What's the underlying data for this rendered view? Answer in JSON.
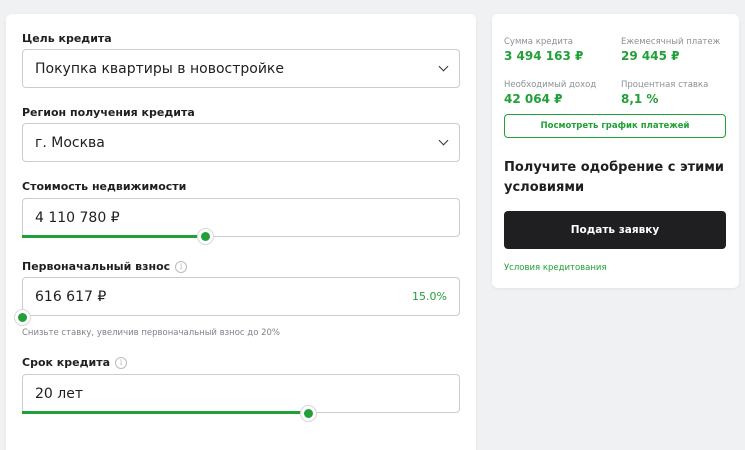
{
  "form": {
    "purpose": {
      "label": "Цель кредита",
      "value": "Покупка квартиры в новостройке"
    },
    "region": {
      "label": "Регион получения кредита",
      "value": "г. Москва"
    },
    "property_cost": {
      "label": "Стоимость недвижимости",
      "value": "4 110 780 ₽",
      "slider_fraction": 0.42
    },
    "down_payment": {
      "label": "Первоначальный взнос",
      "value": "616 617 ₽",
      "percent": "15.0%",
      "slider_fraction": 0.0,
      "hint": "Снизьте ставку, увеличив первоначальный взнос до 20%"
    },
    "term": {
      "label": "Срок кредита",
      "value": "20 лет",
      "slider_fraction": 0.655
    }
  },
  "summary": {
    "loan_amount": {
      "label": "Сумма кредита",
      "value": "3 494 163 ₽"
    },
    "monthly_payment": {
      "label": "Ежемесячный платеж",
      "value": "29 445 ₽"
    },
    "required_income": {
      "label": "Необходимый доход",
      "value": "42 064 ₽"
    },
    "interest_rate": {
      "label": "Процентная ставка",
      "value": "8,1 %"
    },
    "schedule_button": "Посмотреть график платежей",
    "approval_title": "Получите одобрение с этими условиями",
    "apply_button": "Подать заявку",
    "terms_link": "Условия кредитования"
  },
  "colors": {
    "accent": "#21a038",
    "dark": "#1f1f22",
    "background": "#f0f1f3"
  },
  "icons": {
    "dropdown": "chevron-down-icon",
    "info": "info-icon"
  }
}
